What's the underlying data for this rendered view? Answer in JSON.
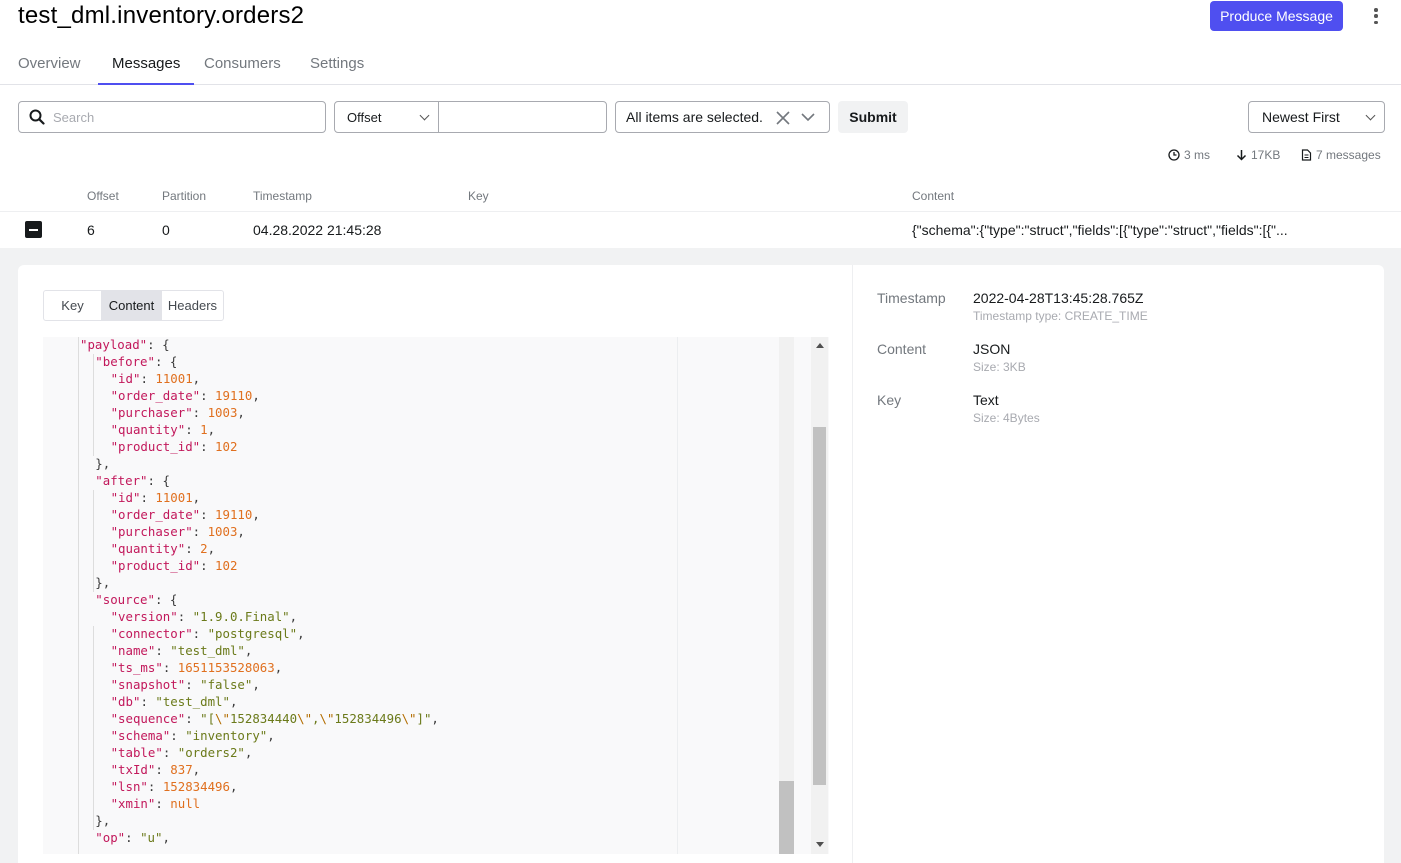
{
  "topic_title": "test_dml.inventory.orders2",
  "produce_button": "Produce Message",
  "tabs": [
    "Overview",
    "Messages",
    "Consumers",
    "Settings"
  ],
  "filters": {
    "search_placeholder": "Search",
    "seek_type": "Offset",
    "offset_value": "",
    "partitions": "All items are selected.",
    "submit_label": "Submit",
    "sort": "Newest First"
  },
  "stats": {
    "elapsed": "3 ms",
    "size": "17KB",
    "messages": "7 messages"
  },
  "table": {
    "headers": [
      "Offset",
      "Partition",
      "Timestamp",
      "Key",
      "Content"
    ],
    "row": {
      "offset": "6",
      "partition": "0",
      "timestamp": "04.28.2022 21:45:28",
      "key": "",
      "content": "{\"schema\":{\"type\":\"struct\",\"fields\":[{\"type\":\"struct\",\"fields\":[{\"..."
    }
  },
  "detail_tabs": [
    "Key",
    "Content",
    "Headers"
  ],
  "code_lines": [
    {
      "i": 2,
      "k": "payload",
      "t": "open"
    },
    {
      "i": 3,
      "k": "before",
      "t": "open"
    },
    {
      "i": 4,
      "k": "id",
      "v": "11001",
      "vt": "num",
      "c": true
    },
    {
      "i": 4,
      "k": "order_date",
      "v": "19110",
      "vt": "num",
      "c": true
    },
    {
      "i": 4,
      "k": "purchaser",
      "v": "1003",
      "vt": "num",
      "c": true
    },
    {
      "i": 4,
      "k": "quantity",
      "v": "1",
      "vt": "num",
      "c": true
    },
    {
      "i": 4,
      "k": "product_id",
      "v": "102",
      "vt": "num",
      "c": false
    },
    {
      "i": 3,
      "t": "close"
    },
    {
      "i": 3,
      "k": "after",
      "t": "open"
    },
    {
      "i": 4,
      "k": "id",
      "v": "11001",
      "vt": "num",
      "c": true
    },
    {
      "i": 4,
      "k": "order_date",
      "v": "19110",
      "vt": "num",
      "c": true
    },
    {
      "i": 4,
      "k": "purchaser",
      "v": "1003",
      "vt": "num",
      "c": true
    },
    {
      "i": 4,
      "k": "quantity",
      "v": "2",
      "vt": "num",
      "c": true
    },
    {
      "i": 4,
      "k": "product_id",
      "v": "102",
      "vt": "num",
      "c": false
    },
    {
      "i": 3,
      "t": "close"
    },
    {
      "i": 3,
      "k": "source",
      "t": "open"
    },
    {
      "i": 4,
      "k": "version",
      "v": "\"1.9.0.Final\"",
      "vt": "str",
      "c": true
    },
    {
      "i": 4,
      "k": "connector",
      "v": "\"postgresql\"",
      "vt": "str",
      "c": true
    },
    {
      "i": 4,
      "k": "name",
      "v": "\"test_dml\"",
      "vt": "str",
      "c": true
    },
    {
      "i": 4,
      "k": "ts_ms",
      "v": "1651153528063",
      "vt": "num",
      "c": true
    },
    {
      "i": 4,
      "k": "snapshot",
      "v": "\"false\"",
      "vt": "str",
      "c": true
    },
    {
      "i": 4,
      "k": "db",
      "v": "\"test_dml\"",
      "vt": "str",
      "c": true
    },
    {
      "i": 4,
      "k": "sequence",
      "v": "\"[\\\"152834440\\\",\\\"152834496\\\"]\"",
      "vt": "seq",
      "c": true
    },
    {
      "i": 4,
      "k": "schema",
      "v": "\"inventory\"",
      "vt": "str",
      "c": true
    },
    {
      "i": 4,
      "k": "table",
      "v": "\"orders2\"",
      "vt": "str",
      "c": true
    },
    {
      "i": 4,
      "k": "txId",
      "v": "837",
      "vt": "num",
      "c": true
    },
    {
      "i": 4,
      "k": "lsn",
      "v": "152834496",
      "vt": "num",
      "c": true
    },
    {
      "i": 4,
      "k": "xmin",
      "v": "null",
      "vt": "num",
      "c": false
    },
    {
      "i": 3,
      "t": "close"
    },
    {
      "i": 3,
      "k": "op",
      "v": "\"u\"",
      "vt": "str",
      "c": true
    }
  ],
  "meta": {
    "timestamp_label": "Timestamp",
    "timestamp_value": "2022-04-28T13:45:28.765Z",
    "timestamp_type": "Timestamp type: CREATE_TIME",
    "content_label": "Content",
    "content_value": "JSON",
    "content_size": "Size: 3KB",
    "key_label": "Key",
    "key_value": "Text",
    "key_size": "Size: 4Bytes"
  }
}
